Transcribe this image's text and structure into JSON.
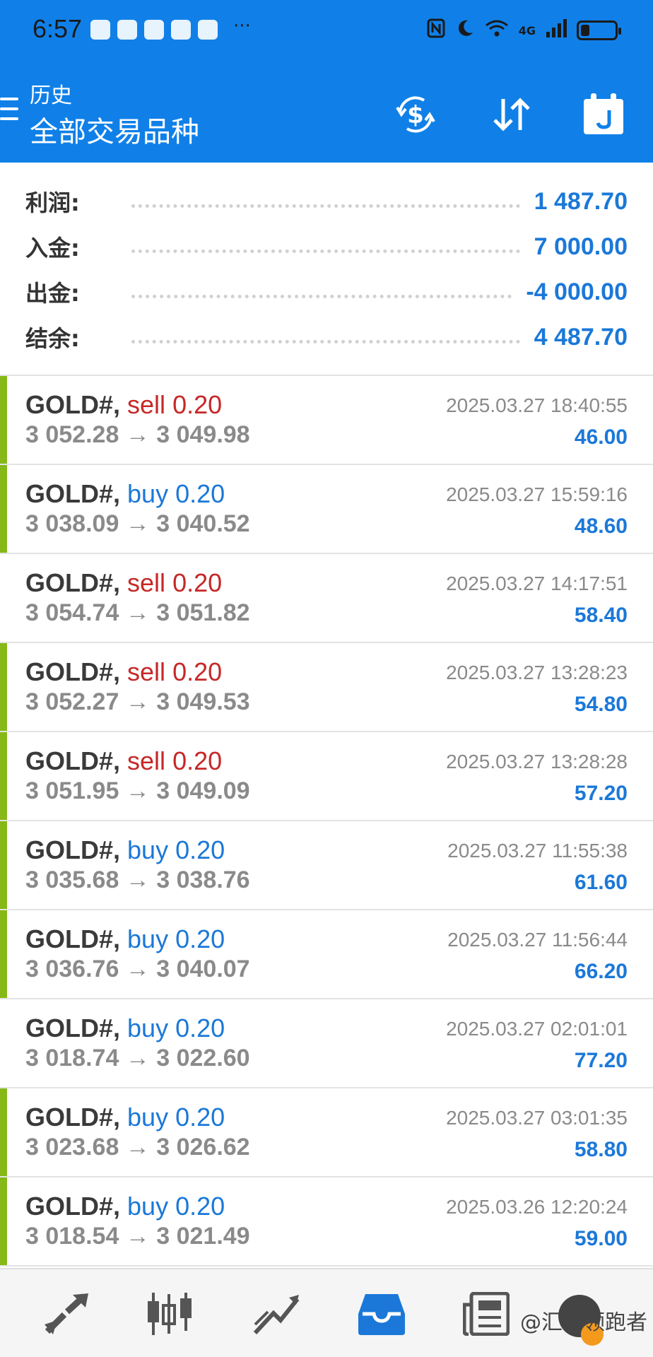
{
  "status_bar": {
    "time": "6:57",
    "dots": "···",
    "network": "4G"
  },
  "header": {
    "subtitle": "历史",
    "title": "全部交易品种"
  },
  "summary": [
    {
      "label": "利润:",
      "value": "1 487.70"
    },
    {
      "label": "入金:",
      "value": "7 000.00"
    },
    {
      "label": "出金:",
      "value": "-4 000.00"
    },
    {
      "label": "结余:",
      "value": "4 487.70"
    }
  ],
  "trades": [
    {
      "symbol": "GOLD#,",
      "side": "sell",
      "volume": "0.20",
      "prices": "3 052.28 → 3 049.98",
      "datetime": "2025.03.27 18:40:55",
      "profit": "46.00",
      "marked": true
    },
    {
      "symbol": "GOLD#,",
      "side": "buy",
      "volume": "0.20",
      "prices": "3 038.09 → 3 040.52",
      "datetime": "2025.03.27 15:59:16",
      "profit": "48.60",
      "marked": true
    },
    {
      "symbol": "GOLD#,",
      "side": "sell",
      "volume": "0.20",
      "prices": "3 054.74 → 3 051.82",
      "datetime": "2025.03.27 14:17:51",
      "profit": "58.40",
      "marked": false
    },
    {
      "symbol": "GOLD#,",
      "side": "sell",
      "volume": "0.20",
      "prices": "3 052.27 → 3 049.53",
      "datetime": "2025.03.27 13:28:23",
      "profit": "54.80",
      "marked": true
    },
    {
      "symbol": "GOLD#,",
      "side": "sell",
      "volume": "0.20",
      "prices": "3 051.95 → 3 049.09",
      "datetime": "2025.03.27 13:28:28",
      "profit": "57.20",
      "marked": true
    },
    {
      "symbol": "GOLD#,",
      "side": "buy",
      "volume": "0.20",
      "prices": "3 035.68 → 3 038.76",
      "datetime": "2025.03.27 11:55:38",
      "profit": "61.60",
      "marked": true
    },
    {
      "symbol": "GOLD#,",
      "side": "buy",
      "volume": "0.20",
      "prices": "3 036.76 → 3 040.07",
      "datetime": "2025.03.27 11:56:44",
      "profit": "66.20",
      "marked": true
    },
    {
      "symbol": "GOLD#,",
      "side": "buy",
      "volume": "0.20",
      "prices": "3 018.74 → 3 022.60",
      "datetime": "2025.03.27 02:01:01",
      "profit": "77.20",
      "marked": false
    },
    {
      "symbol": "GOLD#,",
      "side": "buy",
      "volume": "0.20",
      "prices": "3 023.68 → 3 026.62",
      "datetime": "2025.03.27 03:01:35",
      "profit": "58.80",
      "marked": true
    },
    {
      "symbol": "GOLD#,",
      "side": "buy",
      "volume": "0.20",
      "prices": "3 018.54 → 3 021.49",
      "datetime": "2025.03.26 12:20:24",
      "profit": "59.00",
      "marked": true
    }
  ],
  "bottom_nav": {
    "items": [
      "quotes-icon",
      "chart-icon",
      "trade-icon",
      "history-icon",
      "news-icon"
    ],
    "active": "history-icon",
    "watermark": "@汇市领跑者"
  },
  "colors": {
    "header_blue": "#1080e8",
    "sell_red": "#c62828",
    "buy_blue": "#1b78d8",
    "marker_green": "#86b817"
  }
}
